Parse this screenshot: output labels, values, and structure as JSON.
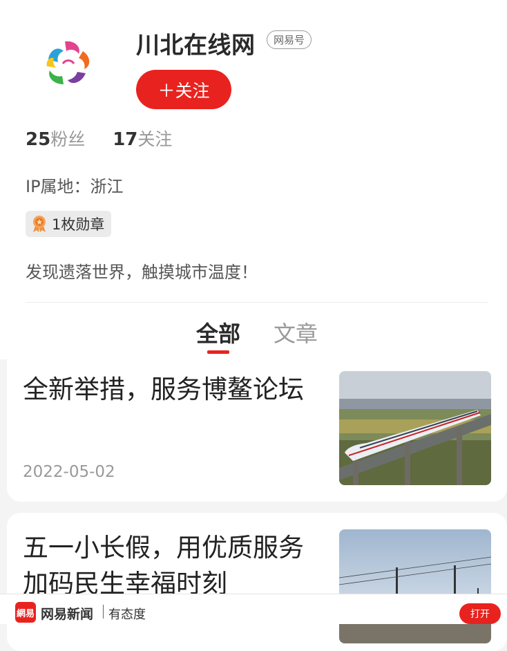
{
  "profile": {
    "name": "川北在线网",
    "platform_badge": "网易号",
    "follow_label": "＋关注",
    "followers_count": "25",
    "followers_label": "粉丝",
    "following_count": "17",
    "following_label": "关注",
    "ip_location": "IP属地：浙江",
    "medal_label": "1枚勋章",
    "bio": "发现遗落世界，触摸城市温度！"
  },
  "tabs": [
    {
      "label": "全部",
      "active": true
    },
    {
      "label": "文章",
      "active": false
    }
  ],
  "articles": [
    {
      "title": "全新举措，服务博鳌论坛",
      "date": "2022-05-02",
      "thumb_icon": "high-speed-train-image"
    },
    {
      "title": "五一小长假，用优质服务加码民生幸福时刻",
      "date": "",
      "thumb_icon": "railway-catenary-image"
    }
  ],
  "bottom_bar": {
    "app_logo": "網易",
    "app_name": "网易新闻",
    "slogan": "有态度",
    "open_label": "打开"
  },
  "colors": {
    "accent": "#e8231f"
  }
}
